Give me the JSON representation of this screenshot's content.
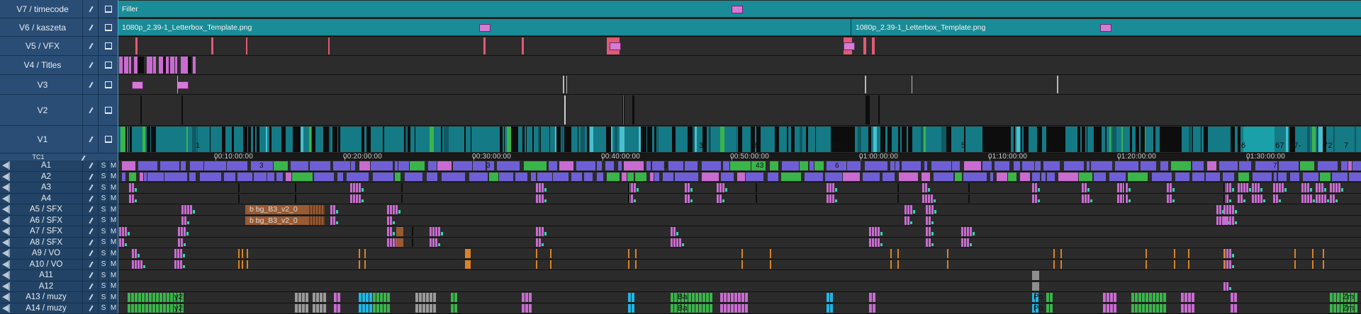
{
  "colors": {
    "header": "#2a4d75",
    "teal": "#1a8c97",
    "teal_dark": "#0f5a63",
    "pink": "#e05a76",
    "pinkclip": "#c96bd1",
    "purple": "#6e5fd6",
    "green": "#39b54a",
    "orange": "#d98324",
    "brown": "#9a5a32",
    "cyan": "#1fb7e6",
    "gray": "#8e8e8e",
    "black": "#0d0d0d"
  },
  "video_tracks": [
    {
      "name": "V7 / timecode"
    },
    {
      "name": "V6 / kaszeta"
    },
    {
      "name": "V5 / VFX"
    },
    {
      "name": "V4 / Titles"
    },
    {
      "name": "V3"
    },
    {
      "name": "V2"
    },
    {
      "name": "V1"
    }
  ],
  "tc_track": {
    "name": "TC1"
  },
  "audio_tracks": [
    {
      "name": "A1",
      "solo": "S",
      "mute": "M"
    },
    {
      "name": "A2",
      "solo": "S",
      "mute": "M"
    },
    {
      "name": "A3",
      "solo": "S",
      "mute": "M"
    },
    {
      "name": "A4",
      "solo": "S",
      "mute": "M"
    },
    {
      "name": "A5 / SFX",
      "solo": "S",
      "mute": "M"
    },
    {
      "name": "A6 / SFX",
      "solo": "S",
      "mute": "M"
    },
    {
      "name": "A7 / SFX",
      "solo": "S",
      "mute": "M"
    },
    {
      "name": "A8 / SFX",
      "solo": "S",
      "mute": "M"
    },
    {
      "name": "A9 / VO",
      "solo": "S",
      "mute": "M"
    },
    {
      "name": "A10 / VO",
      "solo": "S",
      "mute": "M"
    },
    {
      "name": "A11",
      "solo": "S",
      "mute": "M"
    },
    {
      "name": "A12",
      "solo": "S",
      "mute": "M"
    },
    {
      "name": "A13 / muzy",
      "solo": "S",
      "mute": "M"
    },
    {
      "name": "A14 / muzy",
      "solo": "S",
      "mute": "M"
    }
  ],
  "timecodes": [
    "00:10:00:00",
    "00:20:00:00",
    "00:30:00:00",
    "00:40:00:00",
    "00:50:00:00",
    "01:00:00:00",
    "01:10:00:00",
    "01:20:00:00",
    "01:30:00:00"
  ],
  "v7_clip_label": "Filler",
  "v6_clip_labels": [
    "1080p_2.39-1_Letterbox_Template.png",
    "1080p_2.39-1_Letterbox_Template.png"
  ],
  "a5_clip_label": "b  bg_B3_v2_0",
  "a6_clip_label": "b  bg_B3_v2_0",
  "v1_markers": [
    "1",
    "3",
    "3",
    "43",
    "4",
    "5",
    "6",
    "67",
    "67-",
    "72",
    "7"
  ],
  "a1_markers": [
    "3",
    "3",
    "3",
    "43",
    "6",
    "7"
  ],
  "a13_markers": [
    "y2",
    "Ba",
    "Po",
    "Zm"
  ],
  "a14_markers": [
    "y2",
    "Ba",
    "Po",
    "Zm"
  ],
  "icons": {
    "edit": "pencil-icon",
    "monitor": "monitor-icon",
    "speaker": "speaker-icon"
  }
}
